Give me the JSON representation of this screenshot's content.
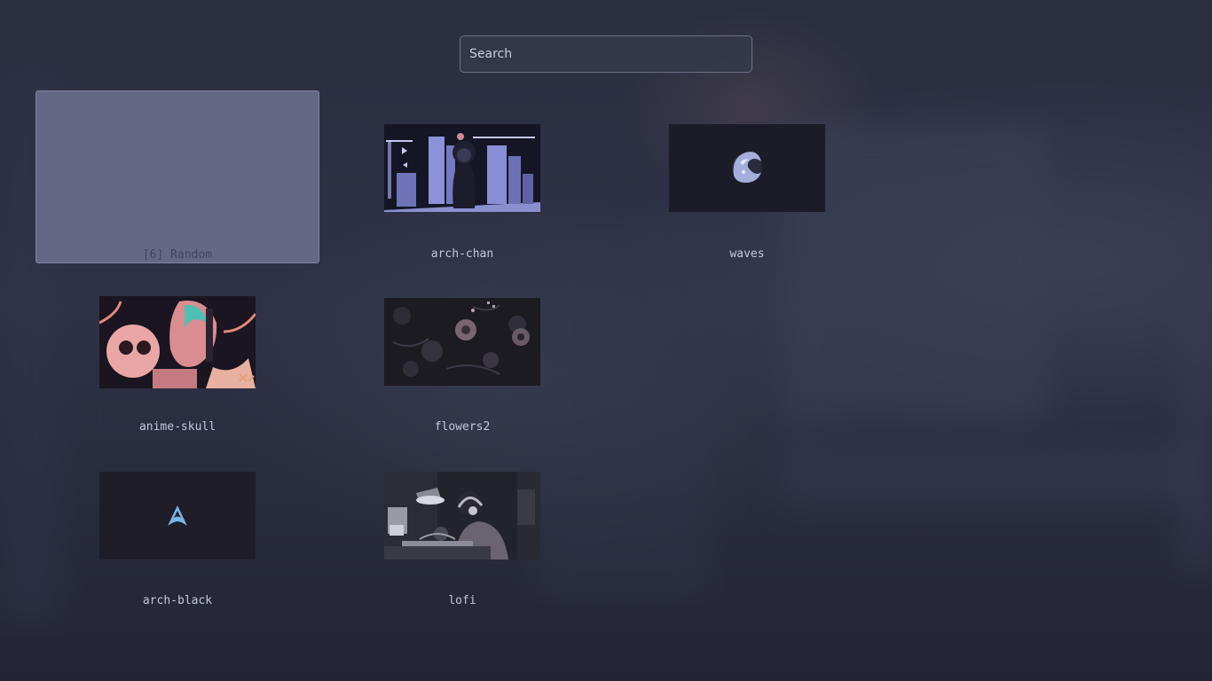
{
  "search": {
    "placeholder": "Search",
    "value": ""
  },
  "items": [
    {
      "label": "[6] Random",
      "selected": true
    },
    {
      "label": "arch-chan"
    },
    {
      "label": "waves"
    },
    {
      "label": "anime-skull"
    },
    {
      "label": "flowers2"
    },
    {
      "label": "arch-black"
    },
    {
      "label": "lofi"
    }
  ],
  "colors": {
    "background": "#2a2d3f",
    "selected_tile": "#636985",
    "text": "#c3c8de",
    "accent_blue": "#7ab4e8"
  }
}
